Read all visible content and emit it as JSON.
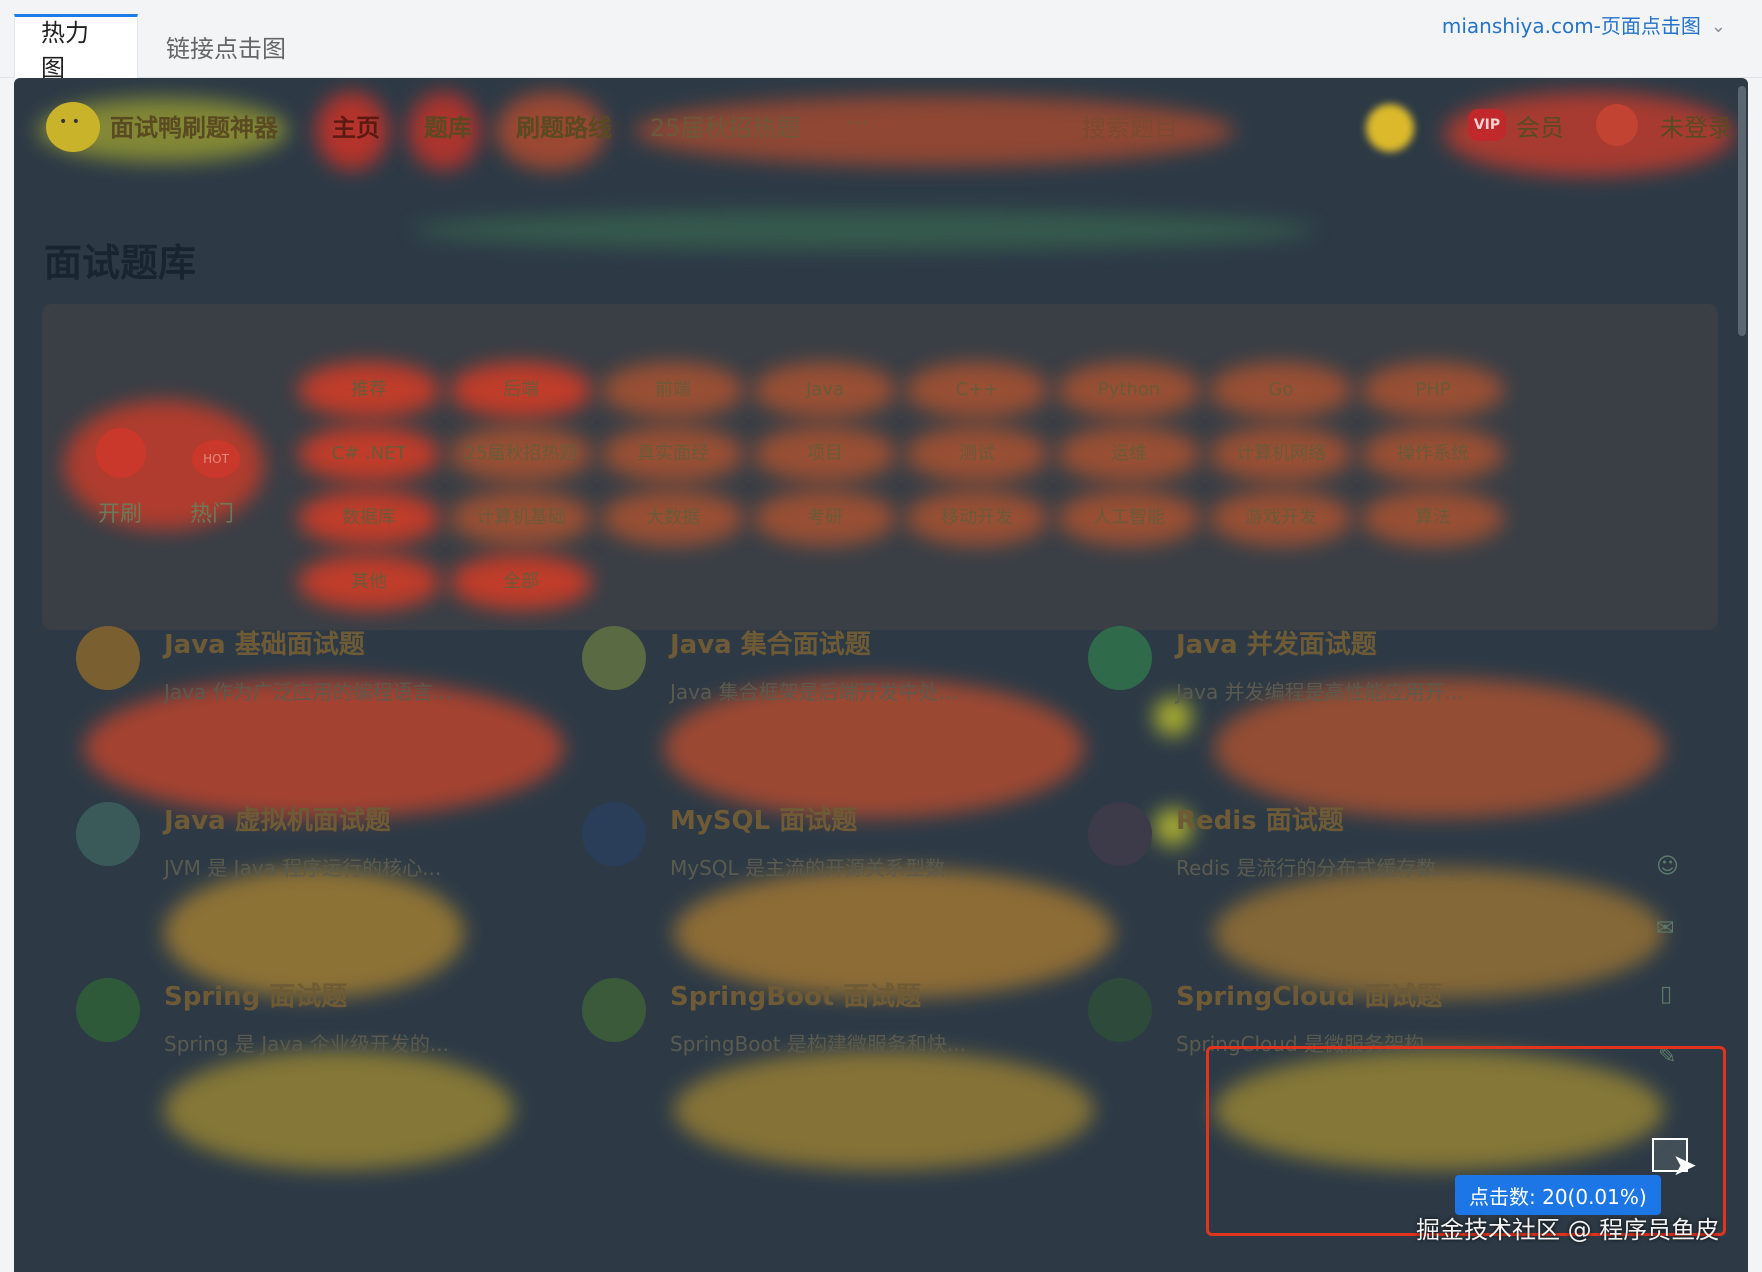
{
  "tabs": [
    {
      "label": "热力图",
      "active": true
    },
    {
      "label": "链接点击图",
      "active": false
    }
  ],
  "site_selector": {
    "label": "mianshiya.com-页面点击图"
  },
  "preview": {
    "nav": {
      "brand": "面试鸭刷题神器",
      "items": [
        "主页",
        "题库",
        "刷题路线",
        "25届秋招热题",
        "...",
        "搜索题目"
      ],
      "vip_badge": "VIP",
      "member": "会员",
      "login": "未登录"
    },
    "page_title": "面试题库",
    "sidebar": {
      "fresh": "开刷",
      "hot": "热门",
      "hot_badge": "HOT"
    },
    "categories": [
      "推荐",
      "后端",
      "前端",
      "Java",
      "C++",
      "Python",
      "Go",
      "PHP",
      "C# .NET",
      "25届秋招热题",
      "真实面经",
      "项目",
      "测试",
      "运维",
      "计算机网络",
      "操作系统",
      "数据库",
      "计算机基础",
      "大数据",
      "考研",
      "移动开发",
      "人工智能",
      "游戏开发",
      "算法",
      "其他",
      "全部"
    ],
    "cards": [
      {
        "title": "Java 基础面试题",
        "desc": "Java 作为广泛应用的编程语言..."
      },
      {
        "title": "Java 集合面试题",
        "desc": "Java 集合框架是后端开发中处..."
      },
      {
        "title": "Java 并发面试题",
        "desc": "Java 并发编程是高性能应用开..."
      },
      {
        "title": "Java 虚拟机面试题",
        "desc": "JVM 是 Java 程序运行的核心..."
      },
      {
        "title": "MySQL 面试题",
        "desc": "MySQL 是主流的开源关系型数..."
      },
      {
        "title": "Redis 面试题",
        "desc": "Redis 是流行的分布式缓存数..."
      },
      {
        "title": "Spring 面试题",
        "desc": "Spring 是 Java 企业级开发的..."
      },
      {
        "title": "SpringBoot 面试题",
        "desc": "SpringBoot 是构建微服务和快..."
      },
      {
        "title": "SpringCloud 面试题",
        "desc": "SpringCloud 是微服务架构"
      }
    ]
  },
  "tooltip": {
    "text": "点击数: 20(0.01%)"
  },
  "watermark": "掘金技术社区 @ 程序员鱼皮",
  "colors": {
    "accent": "#1d76e6",
    "highlight": "#e1341e",
    "heat_hot": "#e02a1e",
    "heat_mid": "#e8d12a",
    "heat_cool": "#3aa76a"
  }
}
